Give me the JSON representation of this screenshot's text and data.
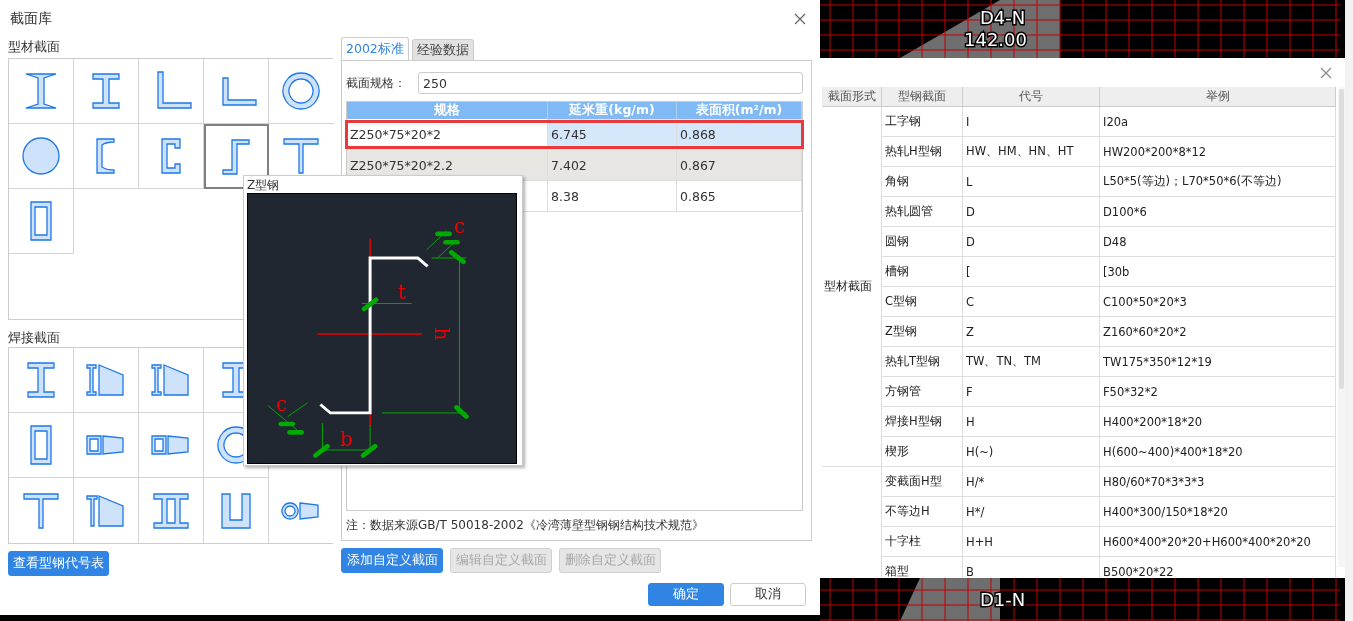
{
  "background": {
    "labels": [
      "D4-N",
      "142.00",
      "D1-N"
    ]
  },
  "section_library": {
    "title": "截面库",
    "profile_label": "型材截面",
    "profile_cells": [
      {
        "kind": "i-tapered",
        "selected": false
      },
      {
        "kind": "i",
        "selected": false
      },
      {
        "kind": "angle-equal",
        "selected": false
      },
      {
        "kind": "angle-unequal",
        "selected": false
      },
      {
        "kind": "pipe",
        "selected": false
      },
      {
        "kind": "round",
        "selected": false
      },
      {
        "kind": "channel",
        "selected": false
      },
      {
        "kind": "c",
        "selected": false
      },
      {
        "kind": "z",
        "selected": true
      },
      {
        "kind": "t",
        "selected": false
      },
      {
        "kind": "rect-tube",
        "selected": false
      }
    ],
    "welded_label": "焊接截面",
    "welded_rows": [
      [
        {
          "kind": "i",
          "selected": false
        },
        {
          "kind": "i-wedge",
          "selected": false
        },
        {
          "kind": "i-wedge",
          "selected": false
        },
        {
          "kind": "i",
          "selected": false
        }
      ],
      [
        {
          "kind": "rect-tube",
          "selected": false
        },
        {
          "kind": "box-wedge",
          "selected": false
        },
        {
          "kind": "box-wedge",
          "selected": false
        },
        {
          "kind": "pipe",
          "selected": false
        }
      ],
      [
        {
          "kind": "t",
          "selected": false
        },
        {
          "kind": "t-wedge",
          "selected": false
        },
        {
          "kind": "double-i",
          "selected": false
        },
        {
          "kind": "u",
          "selected": false
        },
        {
          "kind": "tube-wedge",
          "selected": false
        }
      ]
    ],
    "code_table_button": "查看型钢代号表",
    "tabs": [
      {
        "label": "2002标准",
        "selected": true
      },
      {
        "label": "经验数据",
        "selected": false
      }
    ],
    "spec_label": "截面规格：",
    "spec_value": "250",
    "columns": [
      "规格",
      "延米重(kg/m)",
      "表面积(m²/m)"
    ],
    "rows": [
      {
        "spec": "Z250*75*20*2",
        "weight": "6.745",
        "area": "0.868",
        "selected": true,
        "marked": true
      },
      {
        "spec": "Z250*75*20*2.2",
        "weight": "7.402",
        "area": "0.867",
        "selected": false,
        "marked": false
      },
      {
        "weight": "8.38",
        "area": "0.865",
        "selected": false,
        "marked": false
      }
    ],
    "note": "注：数据来源GB/T 50018-2002《冷湾薄壁型钢钢结构技术规范》",
    "actions": [
      {
        "label": "添加自定义截面",
        "disabled": false
      },
      {
        "label": "编辑自定义截面",
        "disabled": true
      },
      {
        "label": "删除自定义截面",
        "disabled": true
      }
    ],
    "ok": "确定",
    "cancel": "取消",
    "tooltip": {
      "title": "Z型钢",
      "labels": [
        "c",
        "t",
        "h",
        "c",
        "b"
      ]
    }
  },
  "code_table_dialog": {
    "columns": [
      "截面形式",
      "型钢截面",
      "代号",
      "举例"
    ],
    "groups": [
      {
        "label": "型材截面",
        "rows": [
          [
            "工字钢",
            "I",
            "I20a"
          ],
          [
            "热轧H型钢",
            "HW、HM、HN、HT",
            "HW200*200*8*12"
          ],
          [
            "角钢",
            "L",
            "L50*5(等边)；L70*50*6(不等边)"
          ],
          [
            "热轧圆管",
            "D",
            "D100*6"
          ],
          [
            "圆钢",
            "D",
            "D48"
          ],
          [
            "槽钢",
            "[",
            "[30b"
          ],
          [
            "C型钢",
            "C",
            "C100*50*20*3"
          ],
          [
            "Z型钢",
            "Z",
            "Z160*60*20*2"
          ],
          [
            "热轧T型钢",
            "TW、TN、TM",
            "TW175*350*12*19"
          ],
          [
            "方钢管",
            "F",
            "F50*32*2"
          ],
          [
            "焊接H型钢",
            "H",
            "H400*200*18*20"
          ],
          [
            "楔形",
            "H(~)",
            "H(600~400)*400*18*20"
          ]
        ]
      },
      {
        "rows": [
          [
            "变截面H型",
            "H/*",
            "H80/60*70*3*3*3"
          ],
          [
            "不等边H",
            "H*/",
            "H400*300/150*18*20"
          ],
          [
            "十字柱",
            "H+H",
            "H600*400*20*20+H600*400*20*20"
          ],
          [
            "箱型",
            "B",
            "B500*20*22"
          ]
        ]
      }
    ]
  }
}
